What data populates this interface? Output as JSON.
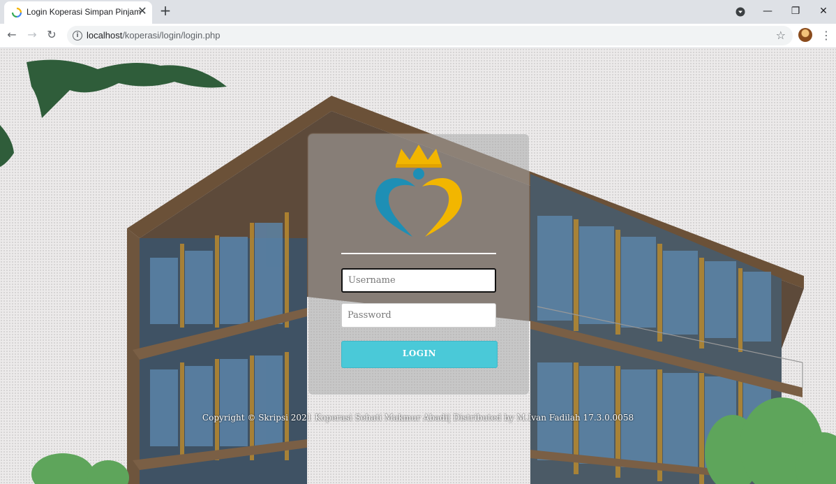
{
  "browser": {
    "tab_title": "Login Koperasi Simpan Pinjam",
    "url_host": "localhost",
    "url_path": "/koperasi/login/login.php"
  },
  "login": {
    "username_placeholder": "Username",
    "password_placeholder": "Password",
    "button_label": "LOGIN"
  },
  "footer": {
    "copyright": "Copyright © Skripsi 2021 Koperasi Sehati Makmur Abadi| Distributed by M.Ivan Fadilah 17.3.0.0058"
  },
  "icons": {
    "logo": "heart-crown-logo",
    "favicon": "loading-favicon",
    "close": "close-icon",
    "new_tab": "plus-icon",
    "back": "back-arrow-icon",
    "forward": "forward-arrow-icon",
    "reload": "reload-icon",
    "info": "info-icon",
    "bookmark": "star-icon",
    "menu": "three-dots-icon"
  },
  "colors": {
    "logo_blue": "#1e8fb5",
    "logo_gold": "#f2b600",
    "button": "#4ac9d8"
  }
}
